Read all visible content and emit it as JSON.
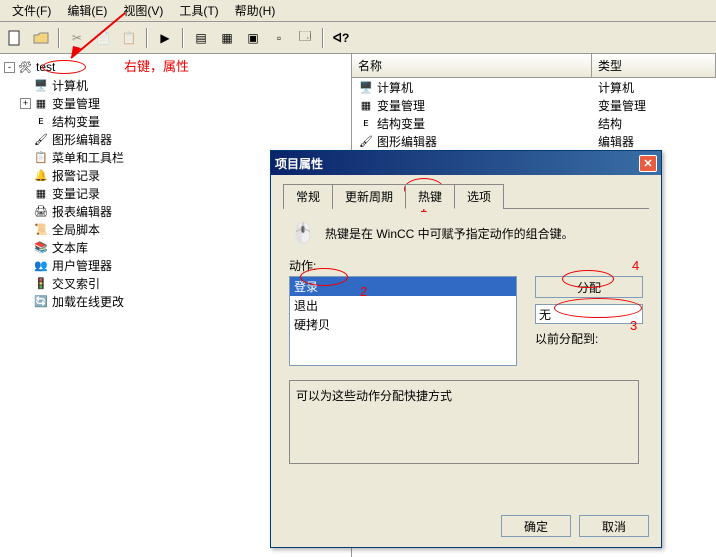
{
  "menu": {
    "file": "文件(F)",
    "edit": "编辑(E)",
    "view": "视图(V)",
    "tools": "工具(T)",
    "help": "帮助(H)"
  },
  "tree": {
    "root": "test",
    "items": [
      {
        "icon": "🖥️",
        "label": "计算机"
      },
      {
        "icon": "▦",
        "label": "变量管理",
        "exp": "+"
      },
      {
        "icon": "ᴇ",
        "label": "结构变量"
      },
      {
        "icon": "🖌",
        "label": "图形编辑器"
      },
      {
        "icon": "📋",
        "label": "菜单和工具栏"
      },
      {
        "icon": "🔔",
        "label": "报警记录"
      },
      {
        "icon": "▦",
        "label": "变量记录"
      },
      {
        "icon": "🖨",
        "label": "报表编辑器"
      },
      {
        "icon": "📜",
        "label": "全局脚本"
      },
      {
        "icon": "📚",
        "label": "文本库"
      },
      {
        "icon": "👥",
        "label": "用户管理器"
      },
      {
        "icon": "🚦",
        "label": "交叉索引"
      },
      {
        "icon": "🔄",
        "label": "加载在线更改"
      }
    ]
  },
  "list": {
    "cols": {
      "name": "名称",
      "type": "类型"
    },
    "rows": [
      {
        "icon": "🖥️",
        "name": "计算机",
        "type": "计算机"
      },
      {
        "icon": "▦",
        "name": "变量管理",
        "type": "变量管理"
      },
      {
        "icon": "ᴇ",
        "name": "结构变量",
        "type": "结构"
      },
      {
        "icon": "🖌",
        "name": "图形编辑器",
        "type": "编辑器"
      }
    ]
  },
  "dialog": {
    "title": "项目属性",
    "tabs": {
      "general": "常规",
      "update": "更新周期",
      "hotkey": "热键",
      "options": "选项"
    },
    "desc": "热键是在 WinCC 中可赋予指定动作的组合键。",
    "action_label": "动作:",
    "actions": [
      {
        "label": "登录",
        "sel": true
      },
      {
        "label": "退出"
      },
      {
        "label": "硬拷贝"
      }
    ],
    "assign": "分配",
    "current": "无",
    "prev_label": "以前分配到:",
    "hint": "可以为这些动作分配快捷方式",
    "ok": "确定",
    "cancel": "取消"
  },
  "ann": {
    "rightclick": "右键，属性",
    "n1": "1",
    "n2": "2",
    "n3": "3",
    "n4": "4"
  }
}
